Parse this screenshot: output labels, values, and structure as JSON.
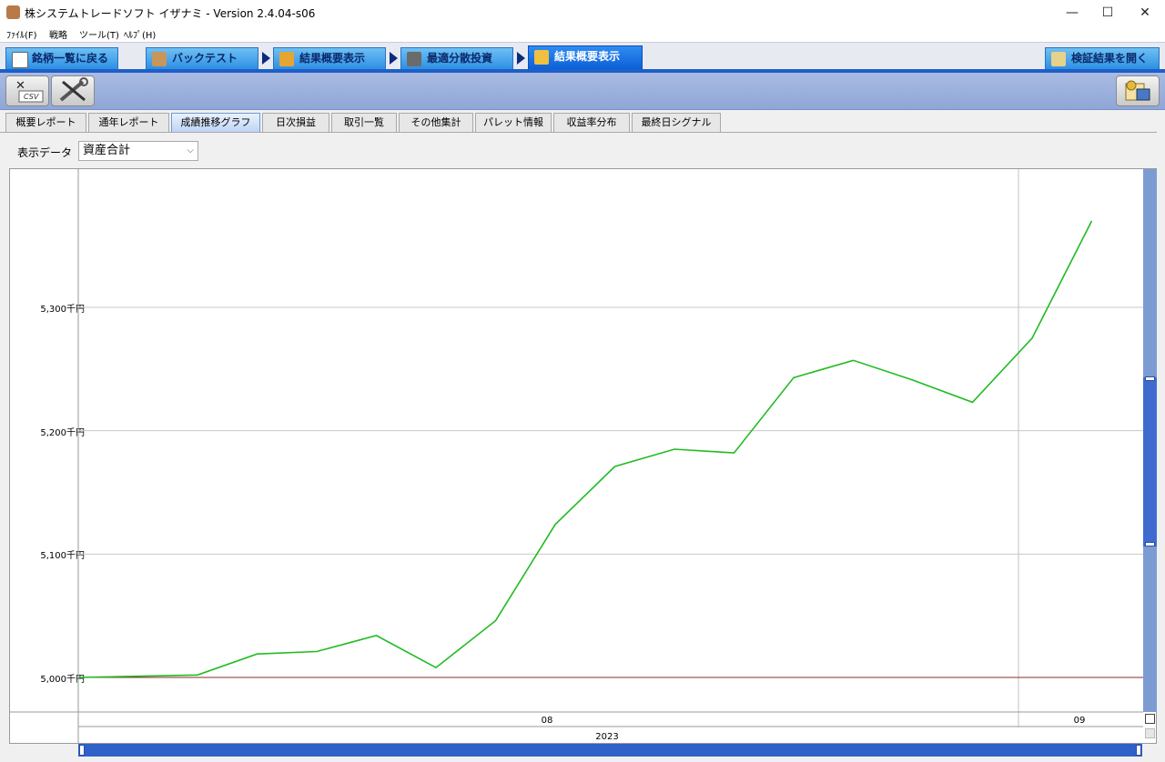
{
  "window": {
    "title": "株システムトレードソフト イザナミ - Version 2.4.04-s06",
    "minimize": "—",
    "maximize": "☐",
    "close": "✕"
  },
  "menu": [
    "ﾌｧｲﾙ(F)",
    "戦略",
    "ツール(T)",
    "ﾍﾙﾌﾟ(H)"
  ],
  "nav": {
    "back": "銘柄一覧に戻る",
    "backtest": "バックテスト",
    "summary": "結果概要表示",
    "optimize": "最適分散投資",
    "summary_active": "結果概要表示",
    "open_result": "検証結果を開く"
  },
  "toolbar": {
    "csv_label": "CSV"
  },
  "tabs": [
    "概要レポート",
    "通年レポート",
    "成績推移グラフ",
    "日次損益",
    "取引一覧",
    "その他集計",
    "パレット情報",
    "収益率分布",
    "最終日シグナル"
  ],
  "active_tab": 2,
  "display": {
    "label": "表示データ",
    "selected": "資産合計"
  },
  "colors": {
    "line": "#22bb22",
    "baseline": "#8b2a2a",
    "grid": "#c8c8c8",
    "accent": "#1e5fc8"
  },
  "chart_data": {
    "type": "line",
    "y_ticks": [
      {
        "value": 5300,
        "label": "5,300千円"
      },
      {
        "value": 5200,
        "label": "5,200千円"
      },
      {
        "value": 5100,
        "label": "5,100千円"
      },
      {
        "value": 5000,
        "label": "5,000千円"
      }
    ],
    "ylim": [
      4972,
      5412
    ],
    "x_month_labels": [
      "08",
      "09"
    ],
    "x_year_label": "2023",
    "baseline": 5000,
    "series": [
      {
        "values": [
          5000,
          5001,
          5002,
          5019,
          5021,
          5034,
          5008,
          5046,
          5124,
          5171,
          5185,
          5182,
          5243,
          5257,
          5241,
          5223,
          5275,
          5370
        ]
      }
    ]
  }
}
